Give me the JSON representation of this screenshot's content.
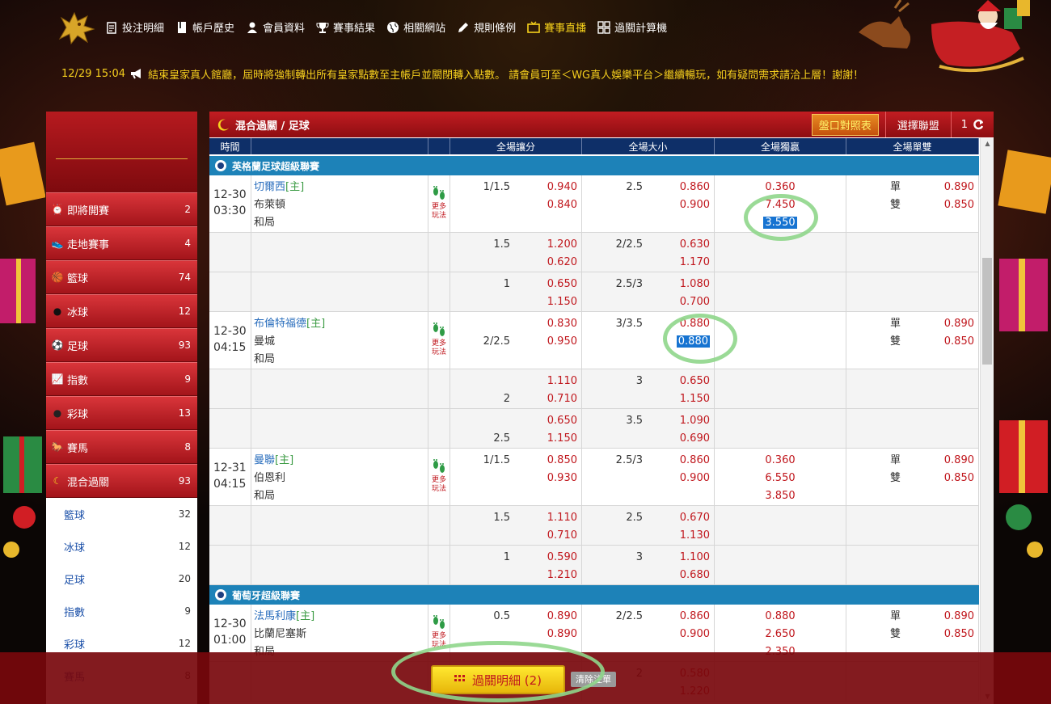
{
  "nav": [
    {
      "label": "投注明細",
      "icon": "clipboard-icon"
    },
    {
      "label": "帳戶歷史",
      "icon": "book-icon"
    },
    {
      "label": "會員資料",
      "icon": "user-icon"
    },
    {
      "label": "賽事結果",
      "icon": "trophy-icon"
    },
    {
      "label": "相關網站",
      "icon": "globe-icon"
    },
    {
      "label": "規則條例",
      "icon": "pencil-icon"
    },
    {
      "label": "賽事直播",
      "icon": "tv-icon"
    },
    {
      "label": "過關計算機",
      "icon": "grid-icon"
    }
  ],
  "nav_active_color": "#f7d21b",
  "marquee": {
    "datetime": "12/29 15:04",
    "text": "結束皇家真人館廳，屆時將強制轉出所有皇家點數至主帳戶並關閉轉入點數。 請會員可至＜WG真人娛樂平台＞繼續暢玩，如有疑問需求請洽上層！謝謝！"
  },
  "sidebar": {
    "items": [
      {
        "label": "即將開賽",
        "count": "2",
        "icon": "alarm-clock-icon"
      },
      {
        "label": "走地賽事",
        "count": "4",
        "icon": "running-shoe-icon"
      },
      {
        "label": "籃球",
        "count": "74",
        "icon": "basketball-icon"
      },
      {
        "label": "冰球",
        "count": "12",
        "icon": "hockey-puck-icon"
      },
      {
        "label": "足球",
        "count": "93",
        "icon": "soccer-ball-icon"
      },
      {
        "label": "指數",
        "count": "9",
        "icon": "chart-icon"
      },
      {
        "label": "彩球",
        "count": "13",
        "icon": "lottery-ball-icon"
      },
      {
        "label": "賽馬",
        "count": "8",
        "icon": "horse-icon"
      },
      {
        "label": "混合過關",
        "count": "93",
        "icon": "moon-icon"
      }
    ],
    "subitems": [
      {
        "label": "籃球",
        "count": "32"
      },
      {
        "label": "冰球",
        "count": "12"
      },
      {
        "label": "足球",
        "count": "20"
      },
      {
        "label": "指數",
        "count": "9"
      },
      {
        "label": "彩球",
        "count": "12"
      },
      {
        "label": "賽馬",
        "count": "8"
      }
    ]
  },
  "main": {
    "title": "混合過關 / 足球",
    "odds_btn": "盤口對照表",
    "league_btn": "選擇聯盟",
    "refresh_count": "1"
  },
  "columns": [
    "時間",
    "",
    "",
    "全場讓分",
    "全場大小",
    "全場獨贏",
    "全場單雙"
  ],
  "more_label": [
    "更多",
    "玩法"
  ],
  "leagues": [
    {
      "name": "英格蘭足球超級聯賽",
      "matches": [
        {
          "date": "12-30",
          "time": "03:30",
          "home": "切爾西",
          "home_tag": "[主]",
          "away": "布萊頓",
          "draw": "和局",
          "lines": [
            {
              "hdp": [
                "1/1.5",
                ""
              ],
              "hdp_odds": [
                "0.940",
                "0.840"
              ],
              "ou": [
                "2.5",
                ""
              ],
              "ou_odds": [
                "0.860",
                "0.900"
              ],
              "x12": [
                "0.360",
                "7.450",
                "3.550"
              ],
              "oe": [
                [
                  "單",
                  "0.890"
                ],
                [
                  "雙",
                  "0.850"
                ]
              ]
            },
            {
              "hdp": [
                "1.5",
                ""
              ],
              "hdp_odds": [
                "1.200",
                "0.620"
              ],
              "ou": [
                "2/2.5",
                ""
              ],
              "ou_odds": [
                "0.630",
                "1.170"
              ]
            },
            {
              "hdp": [
                "1",
                ""
              ],
              "hdp_odds": [
                "0.650",
                "1.150"
              ],
              "ou": [
                "2.5/3",
                ""
              ],
              "ou_odds": [
                "1.080",
                "0.700"
              ]
            }
          ]
        },
        {
          "date": "12-30",
          "time": "04:15",
          "home": "布倫特福德",
          "home_tag": "[主]",
          "away": "曼城",
          "draw": "和局",
          "lines": [
            {
              "hdp": [
                "",
                "2/2.5"
              ],
              "hdp_odds": [
                "0.830",
                "0.950"
              ],
              "ou": [
                "3/3.5",
                ""
              ],
              "ou_odds": [
                "0.880",
                "0.880"
              ],
              "oe": [
                [
                  "單",
                  "0.890"
                ],
                [
                  "雙",
                  "0.850"
                ]
              ]
            },
            {
              "hdp": [
                "",
                "2"
              ],
              "hdp_odds": [
                "1.110",
                "0.710"
              ],
              "ou": [
                "3",
                ""
              ],
              "ou_odds": [
                "0.650",
                "1.150"
              ]
            },
            {
              "hdp": [
                "",
                "2.5"
              ],
              "hdp_odds": [
                "0.650",
                "1.150"
              ],
              "ou": [
                "3.5",
                ""
              ],
              "ou_odds": [
                "1.090",
                "0.690"
              ]
            }
          ]
        },
        {
          "date": "12-31",
          "time": "04:15",
          "home": "曼聯",
          "home_tag": "[主]",
          "away": "伯恩利",
          "draw": "和局",
          "lines": [
            {
              "hdp": [
                "1/1.5",
                ""
              ],
              "hdp_odds": [
                "0.850",
                "0.930"
              ],
              "ou": [
                "2.5/3",
                ""
              ],
              "ou_odds": [
                "0.860",
                "0.900"
              ],
              "x12": [
                "0.360",
                "6.550",
                "3.850"
              ],
              "oe": [
                [
                  "單",
                  "0.890"
                ],
                [
                  "雙",
                  "0.850"
                ]
              ]
            },
            {
              "hdp": [
                "1.5",
                ""
              ],
              "hdp_odds": [
                "1.110",
                "0.710"
              ],
              "ou": [
                "2.5",
                ""
              ],
              "ou_odds": [
                "0.670",
                "1.130"
              ]
            },
            {
              "hdp": [
                "1",
                ""
              ],
              "hdp_odds": [
                "0.590",
                "1.210"
              ],
              "ou": [
                "3",
                ""
              ],
              "ou_odds": [
                "1.100",
                "0.680"
              ]
            }
          ]
        }
      ]
    },
    {
      "name": "葡萄牙超級聯賽",
      "matches": [
        {
          "date": "12-30",
          "time": "01:00",
          "home": "法馬利康",
          "home_tag": "[主]",
          "away": "比蘭尼塞斯",
          "draw": "和局",
          "lines": [
            {
              "hdp": [
                "0.5",
                ""
              ],
              "hdp_odds": [
                "0.890",
                "0.890"
              ],
              "ou": [
                "2/2.5",
                ""
              ],
              "ou_odds": [
                "0.860",
                "0.900"
              ],
              "x12": [
                "0.880",
                "2.650",
                "2.350"
              ],
              "oe": [
                [
                  "單",
                  "0.890"
                ],
                [
                  "雙",
                  "0.850"
                ]
              ]
            },
            {
              "hdp": [
                "",
                ""
              ],
              "hdp_odds": [
                "",
                ""
              ],
              "ou": [
                "2",
                ""
              ],
              "ou_odds": [
                "0.580",
                "1.220"
              ]
            }
          ]
        }
      ]
    }
  ],
  "footer": {
    "parlay_label": "過關明細 (2)",
    "clear_label": "清除注單"
  },
  "colors": {
    "header_red": "#c21d22",
    "table_header": "#0e2f68",
    "league_bar": "#1d82b8",
    "odds_red": "#c0171d",
    "selected_blue": "#1673d1",
    "highlight_circle": "#8fd68b"
  }
}
